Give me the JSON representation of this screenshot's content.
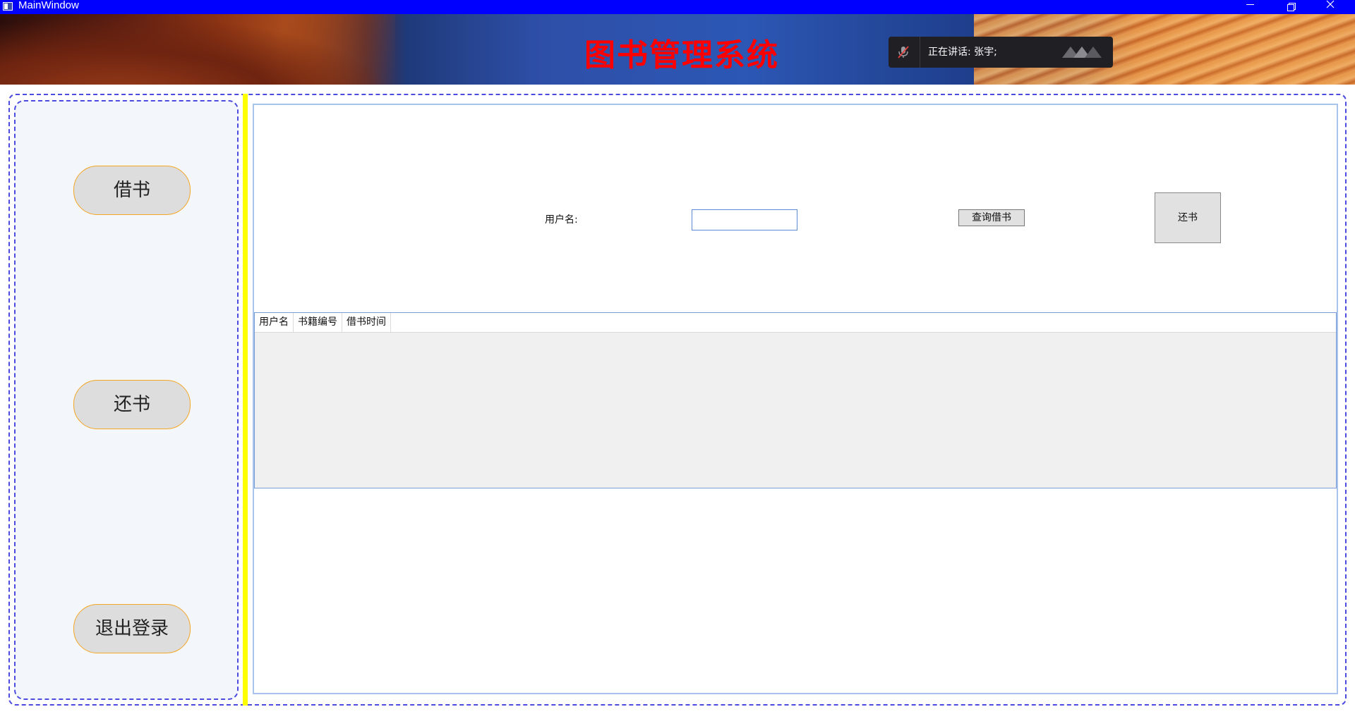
{
  "window": {
    "title": "MainWindow",
    "controls": [
      "minimize",
      "restore",
      "close"
    ]
  },
  "banner": {
    "system_title": "图书管理系统"
  },
  "toast": {
    "speaking_text": "正在讲话: 张宇;",
    "mic_icon": "mic-muted-icon"
  },
  "sidebar": {
    "buttons": [
      {
        "label": "借书"
      },
      {
        "label": "还书"
      },
      {
        "label": "退出登录"
      }
    ]
  },
  "content": {
    "username_label": "用户名:",
    "username_value": "",
    "query_button": "查询借书",
    "return_button": "还书",
    "table": {
      "columns": [
        "用户名",
        "书籍编号",
        "借书时间"
      ],
      "rows": []
    }
  },
  "colors": {
    "titlebar": "#0000ff",
    "system_title": "#ff0000",
    "splitter": "#ffff00",
    "nav_button_border": "#f5a623",
    "dashed_border": "#4b4be0"
  }
}
